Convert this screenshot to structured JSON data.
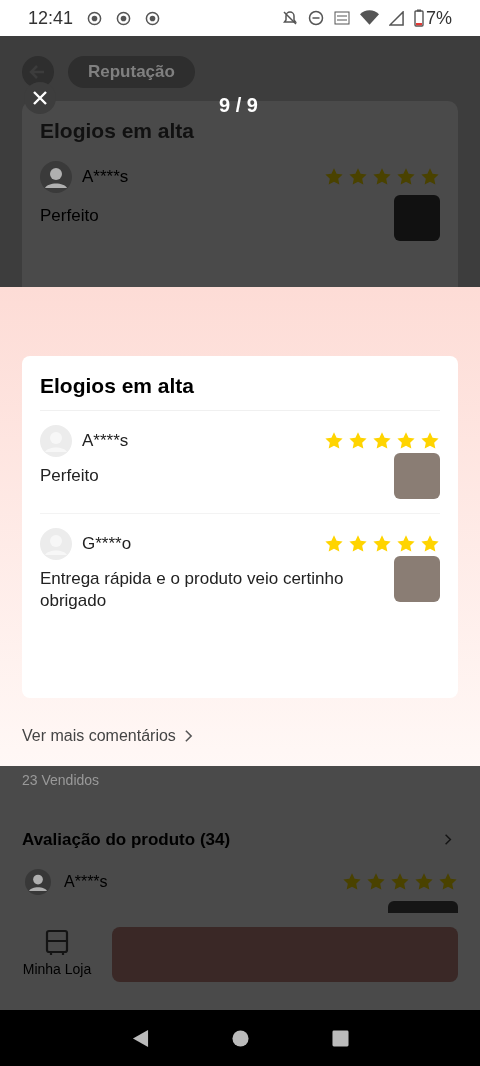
{
  "status_bar": {
    "time": "12:41",
    "battery": "7%"
  },
  "background_page": {
    "tab_text": "Reputação",
    "section_title": "Elogios em alta",
    "review": {
      "user": "A****s",
      "stars": 5,
      "text": "Perfeito"
    },
    "sold": "23 Vendidos",
    "rating_title": "Avaliação do produto (34)",
    "rating_review": {
      "user": "A****s",
      "stars": 5
    },
    "store_label": "Minha Loja"
  },
  "viewer": {
    "counter": "9 / 9"
  },
  "panel": {
    "title": "Elogios em alta",
    "reviews": [
      {
        "user": "A****s",
        "stars": 5,
        "text": "Perfeito"
      },
      {
        "user": "G****o",
        "stars": 5,
        "text": "Entrega rápida e o produto veio certinho obrigado"
      }
    ],
    "more_link": "Ver mais comentários"
  }
}
